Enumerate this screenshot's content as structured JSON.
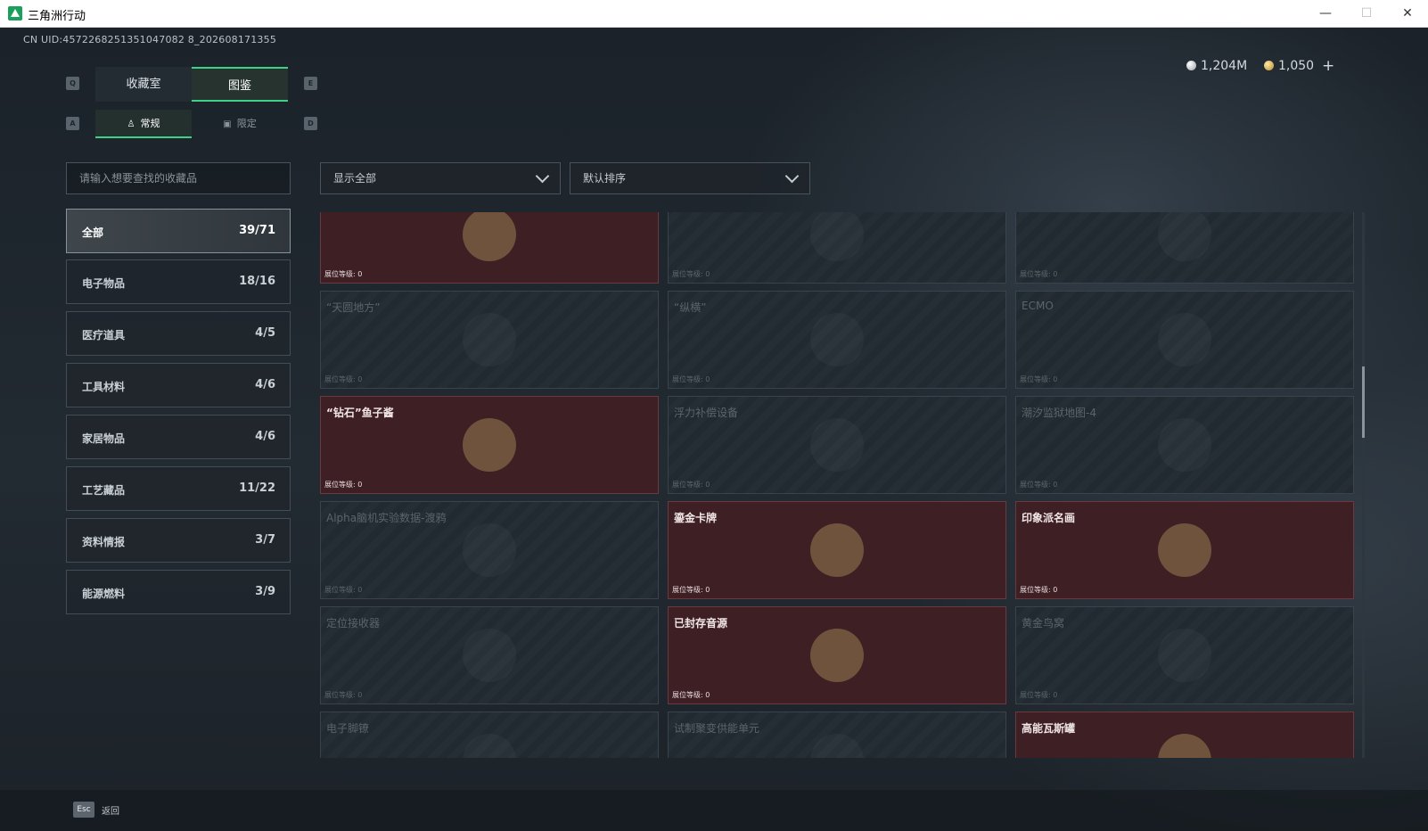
{
  "window": {
    "title": "三角洲行动",
    "min": "—",
    "max": "☐",
    "close": "✕"
  },
  "uid": "CN UID:4572268251351047082 8_202608171355",
  "currency": {
    "silver": "1,204M",
    "gold": "1,050",
    "plus": "+"
  },
  "keys": {
    "q": "Q",
    "e": "E",
    "a": "A",
    "d": "D"
  },
  "tabs": {
    "collection_room": "收藏室",
    "catalog": "图鉴"
  },
  "subtabs": {
    "regular": "常规",
    "limited": "限定"
  },
  "search": {
    "placeholder": "请输入想要查找的收藏品"
  },
  "filters": {
    "show": "显示全部",
    "sort": "默认排序"
  },
  "categories": [
    {
      "name": "全部",
      "count": "39/71"
    },
    {
      "name": "电子物品",
      "count": "18/16"
    },
    {
      "name": "医疗道具",
      "count": "4/5"
    },
    {
      "name": "工具材料",
      "count": "4/6"
    },
    {
      "name": "家居物品",
      "count": "4/6"
    },
    {
      "name": "工艺藏品",
      "count": "11/22"
    },
    {
      "name": "资料情报",
      "count": "3/7"
    },
    {
      "name": "能源燃料",
      "count": "3/9"
    }
  ],
  "level_label": "展位等级: 0",
  "cards": [
    {
      "name": "",
      "owned": true,
      "icon": "robot-arm-icon"
    },
    {
      "name": "",
      "owned": false,
      "icon": "globe-icon"
    },
    {
      "name": "",
      "owned": false,
      "icon": "bowl-icon"
    },
    {
      "name": "“天圆地方”",
      "owned": false,
      "icon": "globe-icon"
    },
    {
      "name": "“纵横”",
      "owned": false,
      "icon": "chessboard-icon"
    },
    {
      "name": "ECMO",
      "owned": false,
      "icon": "machine-icon"
    },
    {
      "name": "“钻石”鱼子酱",
      "owned": true,
      "icon": "caviar-tin-icon"
    },
    {
      "name": "浮力补偿设备",
      "owned": false,
      "icon": "vest-icon"
    },
    {
      "name": "潮汐监狱地图-4",
      "owned": false,
      "icon": "map-icon"
    },
    {
      "name": "Alpha脑机实验数据-渡鸦",
      "owned": false,
      "icon": "data-drive-icon"
    },
    {
      "name": "鎏金卡牌",
      "owned": true,
      "icon": "gold-card-icon"
    },
    {
      "name": "印象派名画",
      "owned": true,
      "icon": "painting-icon"
    },
    {
      "name": "定位接收器",
      "owned": false,
      "icon": "receiver-icon"
    },
    {
      "name": "已封存音源",
      "owned": true,
      "icon": "tape-recorder-icon"
    },
    {
      "name": "黄金鸟窝",
      "owned": false,
      "icon": "nest-icon"
    },
    {
      "name": "电子脚镣",
      "owned": false,
      "icon": "anklet-icon"
    },
    {
      "name": "试制聚变供能单元",
      "owned": false,
      "icon": "fusion-unit-icon"
    },
    {
      "name": "高能瓦斯罐",
      "owned": true,
      "icon": "gas-canister-icon"
    }
  ],
  "footer": {
    "esc": "Esc",
    "back": "返回"
  },
  "colors": {
    "accent": "#3fd08a",
    "owned_bg": "#3d1f24",
    "locked_bg": "#222a31"
  }
}
